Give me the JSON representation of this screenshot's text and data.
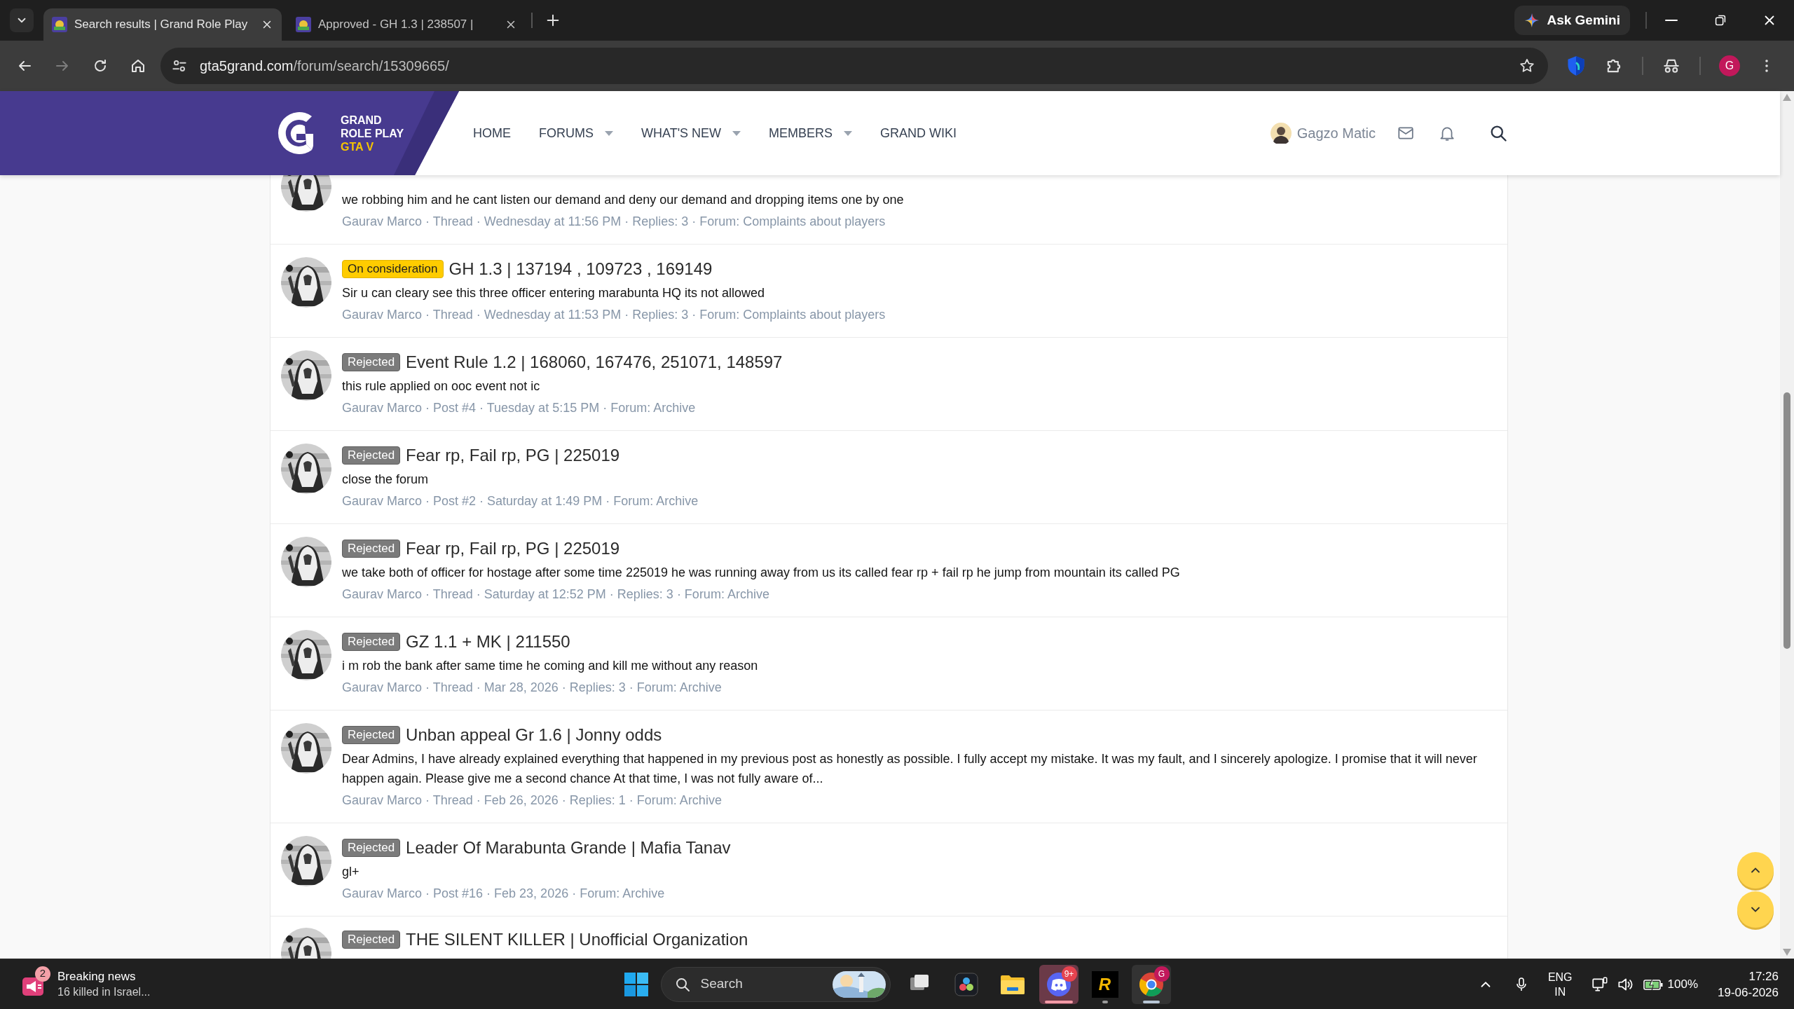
{
  "browser": {
    "tabs": [
      {
        "title": "Search results | Grand Role Play",
        "selected": true
      },
      {
        "title": "Approved - GH 1.3 | 238507 |",
        "selected": false
      }
    ],
    "gemini_button": "Ask Gemini",
    "address": {
      "host": "gta5grand.com",
      "path": "/forum/search/15309665/"
    },
    "profile_initial": "G"
  },
  "site": {
    "logo_lines": [
      "GRAND",
      "ROLE PLAY",
      "GTA V"
    ],
    "nav": [
      {
        "label": "HOME",
        "has_menu": false
      },
      {
        "label": "FORUMS",
        "has_menu": true
      },
      {
        "label": "WHAT'S NEW",
        "has_menu": true
      },
      {
        "label": "MEMBERS",
        "has_menu": true
      },
      {
        "label": "GRAND WIKI",
        "has_menu": false
      }
    ],
    "user_name": "Gagzo Matic"
  },
  "results": [
    {
      "kind": "cut_off",
      "snippet": "we robbing him and he cant listen our demand and deny our demand and dropping items one by one",
      "meta": "Gaurav Marco · Thread · Wednesday at 11:56 PM · Replies: 3 · Forum: Complaints about players"
    },
    {
      "kind": "full",
      "badge": {
        "label": "On consideration",
        "kind": "consideration"
      },
      "title": "GH 1.3 | 137194 , 109723 , 169149",
      "snippet": "Sir u can cleary see this three officer entering marabunta HQ its not allowed",
      "meta": "Gaurav Marco · Thread · Wednesday at 11:53 PM · Replies: 3 · Forum: Complaints about players"
    },
    {
      "kind": "full",
      "badge": {
        "label": "Rejected",
        "kind": "rejected"
      },
      "title": "Event Rule 1.2 | 168060, 167476, 251071, 148597",
      "snippet": "this rule applied on ooc event not ic",
      "meta": "Gaurav Marco · Post #4 · Tuesday at 5:15 PM · Forum: Archive"
    },
    {
      "kind": "full",
      "badge": {
        "label": "Rejected",
        "kind": "rejected"
      },
      "title": "Fear rp, Fail rp, PG | 225019",
      "snippet": "close the forum",
      "meta": "Gaurav Marco · Post #2 · Saturday at 1:49 PM · Forum: Archive"
    },
    {
      "kind": "full",
      "badge": {
        "label": "Rejected",
        "kind": "rejected"
      },
      "title": "Fear rp, Fail rp, PG | 225019",
      "snippet": "we take both of officer for hostage after some time 225019 he was running away from us its called fear rp + fail rp he jump from mountain its called PG",
      "meta": "Gaurav Marco · Thread · Saturday at 12:52 PM · Replies: 3 · Forum: Archive"
    },
    {
      "kind": "full",
      "badge": {
        "label": "Rejected",
        "kind": "rejected"
      },
      "title": "GZ 1.1 + MK | 211550",
      "snippet": "i m rob the bank after same time he coming and kill me without any reason",
      "meta": "Gaurav Marco · Thread · Mar 28, 2026 · Replies: 3 · Forum: Archive"
    },
    {
      "kind": "full",
      "badge": {
        "label": "Rejected",
        "kind": "rejected"
      },
      "title": "Unban appeal Gr 1.6 | Jonny odds",
      "snippet": "Dear Admins, I have already explained everything that happened in my previous post as honestly as possible. I fully accept my mistake. It was my fault, and I sincerely apologize. I promise that it will never happen again. Please give me a second chance At that time, I was not fully aware of...",
      "meta": "Gaurav Marco · Thread · Feb 26, 2026 · Replies: 1 · Forum: Archive"
    },
    {
      "kind": "full",
      "badge": {
        "label": "Rejected",
        "kind": "rejected"
      },
      "title": "Leader Of Marabunta Grande | Mafia Tanav",
      "snippet": "gl+",
      "meta": "Gaurav Marco · Post #16 · Feb 23, 2026 · Forum: Archive"
    },
    {
      "kind": "cut_bottom",
      "badge": {
        "label": "Rejected",
        "kind": "rejected"
      },
      "title": "THE SILENT KILLER | Unofficial Organization"
    }
  ],
  "taskbar": {
    "news": {
      "count": "2",
      "title": "Breaking news",
      "subtitle": "16 killed in Israel..."
    },
    "search_placeholder": "Search",
    "apps": [
      {
        "kind": "taskview",
        "running": false,
        "attention": false,
        "focused": false
      },
      {
        "kind": "davinci",
        "running": false,
        "attention": false,
        "focused": false
      },
      {
        "kind": "explorer",
        "running": false,
        "attention": false,
        "focused": false
      },
      {
        "kind": "discord",
        "running": true,
        "attention": true,
        "focused": false,
        "badge": "9+"
      },
      {
        "kind": "rockstar",
        "running": true,
        "attention": false,
        "focused": false,
        "glyph": "R"
      },
      {
        "kind": "chrome",
        "running": true,
        "attention": false,
        "focused": true,
        "badge": "G"
      }
    ],
    "language": [
      "ENG",
      "IN"
    ],
    "battery": "100%",
    "time": "17:26",
    "date": "19-06-2026"
  }
}
